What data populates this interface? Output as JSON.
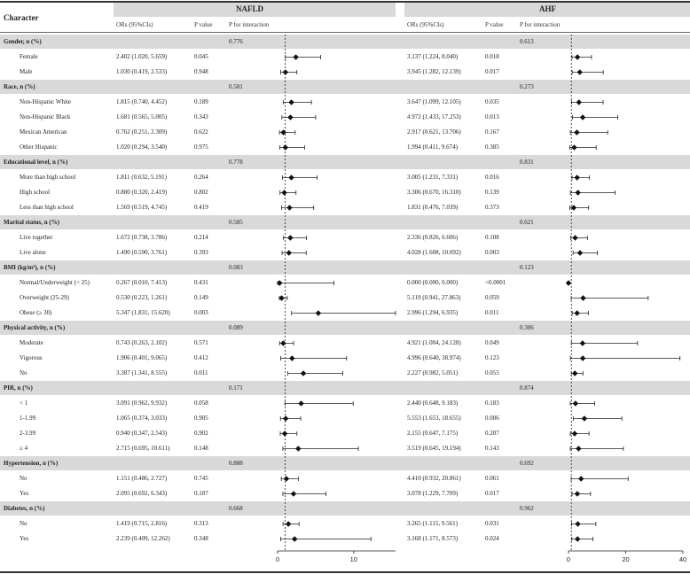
{
  "header": {
    "character": "Character",
    "nafld": "NAFLD",
    "ahf": "AHF",
    "or_label": "ORs (95%CIs)",
    "p_label": "P value",
    "pint_label": "P for interaction"
  },
  "axes": {
    "nafld": {
      "ticks": [
        0,
        10
      ],
      "xmin": 0,
      "xmax": 15.5,
      "ref": 1
    },
    "ahf": {
      "ticks": [
        0,
        20,
        40
      ],
      "xmin": 0,
      "xmax": 40,
      "ref": 1
    }
  },
  "chart_data": {
    "type": "forest",
    "groups": [
      {
        "name": "Gender, n (%)",
        "p_int_nafld": "0.776",
        "p_int_ahf": "0.613",
        "rows": [
          {
            "label": "Female",
            "nafld": {
              "text": "2.402 (1.020, 5.659)",
              "p": "0.045",
              "or": 2.402,
              "lo": 1.02,
              "hi": 5.659
            },
            "ahf": {
              "text": "3.137 (1.224, 8.040)",
              "p": "0.018",
              "or": 3.137,
              "lo": 1.224,
              "hi": 8.04
            }
          },
          {
            "label": "Male",
            "nafld": {
              "text": "1.030 (0.419, 2.533)",
              "p": "0.948",
              "or": 1.03,
              "lo": 0.419,
              "hi": 2.533
            },
            "ahf": {
              "text": "3.945 (1.282, 12.139)",
              "p": "0.017",
              "or": 3.945,
              "lo": 1.282,
              "hi": 12.139
            }
          }
        ]
      },
      {
        "name": "Race, n (%)",
        "p_int_nafld": "0.581",
        "p_int_ahf": "0.273",
        "rows": [
          {
            "label": "Non-Hispanic White",
            "nafld": {
              "text": "1.815 (0.740, 4.452)",
              "p": "0.189",
              "or": 1.815,
              "lo": 0.74,
              "hi": 4.452
            },
            "ahf": {
              "text": "3.647 (1.099, 12.105)",
              "p": "0.035",
              "or": 3.647,
              "lo": 1.099,
              "hi": 12.105
            }
          },
          {
            "label": "Non-Hispanic Black",
            "nafld": {
              "text": "1.681 (0.565, 5.005)",
              "p": "0.343",
              "or": 1.681,
              "lo": 0.565,
              "hi": 5.005
            },
            "ahf": {
              "text": "4.972 (1.433, 17.253)",
              "p": "0.013",
              "or": 4.972,
              "lo": 1.433,
              "hi": 17.253
            }
          },
          {
            "label": "Mexican American",
            "nafld": {
              "text": "0.762 (0.251, 2.309)",
              "p": "0.622",
              "or": 0.762,
              "lo": 0.251,
              "hi": 2.309
            },
            "ahf": {
              "text": "2.917 (0.621, 13.706)",
              "p": "0.167",
              "or": 2.917,
              "lo": 0.621,
              "hi": 13.706
            }
          },
          {
            "label": "Other Hispanic",
            "nafld": {
              "text": "1.020 (0.294, 3.540)",
              "p": "0.975",
              "or": 1.02,
              "lo": 0.294,
              "hi": 3.54
            },
            "ahf": {
              "text": "1.994 (0.411, 9.674)",
              "p": "0.385",
              "or": 1.994,
              "lo": 0.411,
              "hi": 9.674
            }
          }
        ]
      },
      {
        "name": "Educational level, n (%)",
        "p_int_nafld": "0.778",
        "p_int_ahf": "0.831",
        "rows": [
          {
            "label": "More than high school",
            "nafld": {
              "text": "1.811 (0.632, 5.191)",
              "p": "0.264",
              "or": 1.811,
              "lo": 0.632,
              "hi": 5.191
            },
            "ahf": {
              "text": "3.005 (1.231, 7.331)",
              "p": "0.016",
              "or": 3.005,
              "lo": 1.231,
              "hi": 7.331
            }
          },
          {
            "label": "High school",
            "nafld": {
              "text": "0.880 (0.320, 2.419)",
              "p": "0.802",
              "or": 0.88,
              "lo": 0.32,
              "hi": 2.419
            },
            "ahf": {
              "text": "3.306 (0.670, 16.310)",
              "p": "0.139",
              "or": 3.306,
              "lo": 0.67,
              "hi": 16.31
            }
          },
          {
            "label": "Less than high school",
            "nafld": {
              "text": "1.569 (0.519, 4.745)",
              "p": "0.419",
              "or": 1.569,
              "lo": 0.519,
              "hi": 4.745
            },
            "ahf": {
              "text": "1.831 (0.476, 7.039)",
              "p": "0.373",
              "or": 1.831,
              "lo": 0.476,
              "hi": 7.039
            }
          }
        ]
      },
      {
        "name": "Marital status, n (%)",
        "p_int_nafld": "0.585",
        "p_int_ahf": "0.621",
        "rows": [
          {
            "label": "Live together",
            "nafld": {
              "text": "1.672 (0.738, 3.786)",
              "p": "0.214",
              "or": 1.672,
              "lo": 0.738,
              "hi": 3.786
            },
            "ahf": {
              "text": "2.336 (0.826, 6.606)",
              "p": "0.108",
              "or": 2.336,
              "lo": 0.826,
              "hi": 6.606
            }
          },
          {
            "label": "Live alone",
            "nafld": {
              "text": "1.490 (0.590, 3.761)",
              "p": "0.393",
              "or": 1.49,
              "lo": 0.59,
              "hi": 3.761
            },
            "ahf": {
              "text": "4.028 (1.608, 10.092)",
              "p": "0.003",
              "or": 4.028,
              "lo": 1.608,
              "hi": 10.092
            }
          }
        ]
      },
      {
        "name": "BMI (kg/m²), n (%)",
        "p_int_nafld": "0.083",
        "p_int_ahf": "0.123",
        "rows": [
          {
            "label": "Normal/Underweight (< 25)",
            "nafld": {
              "text": "0.267 (0.010, 7.413)",
              "p": "0.431",
              "or": 0.267,
              "lo": 0.01,
              "hi": 7.413
            },
            "ahf": {
              "text": "0.000 (0.000, 0.000)",
              "p": "<0.0001",
              "or": 0.0,
              "lo": 0.0,
              "hi": 0.0
            }
          },
          {
            "label": "Overweight (25-29)",
            "nafld": {
              "text": "0.530 (0.223, 1.261)",
              "p": "0.149",
              "or": 0.53,
              "lo": 0.223,
              "hi": 1.261
            },
            "ahf": {
              "text": "5.119 (0.941, 27.863)",
              "p": "0.059",
              "or": 5.119,
              "lo": 0.941,
              "hi": 27.863
            }
          },
          {
            "label": "Obese (≥ 30)",
            "nafld": {
              "text": "5.347 (1.831, 15.620)",
              "p": "0.003",
              "or": 5.347,
              "lo": 1.831,
              "hi": 15.62
            },
            "ahf": {
              "text": "2.996 (1.294, 6.935)",
              "p": "0.011",
              "or": 2.996,
              "lo": 1.294,
              "hi": 6.935
            }
          }
        ]
      },
      {
        "name": "Physical activity, n (%)",
        "p_int_nafld": "0.089",
        "p_int_ahf": "0.306",
        "rows": [
          {
            "label": "Moderate",
            "nafld": {
              "text": "0.743 (0.263, 2.102)",
              "p": "0.571",
              "or": 0.743,
              "lo": 0.263,
              "hi": 2.102
            },
            "ahf": {
              "text": "4.921 (1.004, 24.128)",
              "p": "0.049",
              "or": 4.921,
              "lo": 1.004,
              "hi": 24.128
            }
          },
          {
            "label": "Vigorous",
            "nafld": {
              "text": "1.906 (0.401, 9.065)",
              "p": "0.412",
              "or": 1.906,
              "lo": 0.401,
              "hi": 9.065
            },
            "ahf": {
              "text": "4.996 (0.640, 38.974)",
              "p": "0.123",
              "or": 4.996,
              "lo": 0.64,
              "hi": 38.974
            }
          },
          {
            "label": "No",
            "nafld": {
              "text": "3.387 (1.341, 8.555)",
              "p": "0.011",
              "or": 3.387,
              "lo": 1.341,
              "hi": 8.555
            },
            "ahf": {
              "text": "2.227 (0.982, 5.051)",
              "p": "0.055",
              "or": 2.227,
              "lo": 0.982,
              "hi": 5.051
            }
          }
        ]
      },
      {
        "name": "PIR, n (%)",
        "p_int_nafld": "0.171",
        "p_int_ahf": "0.874",
        "rows": [
          {
            "label": "< 1",
            "nafld": {
              "text": "3.091 (0.962, 9.932)",
              "p": "0.058",
              "or": 3.091,
              "lo": 0.962,
              "hi": 9.932
            },
            "ahf": {
              "text": "2.440 (0.648, 9.183)",
              "p": "0.183",
              "or": 2.44,
              "lo": 0.648,
              "hi": 9.183
            }
          },
          {
            "label": "1-1.99",
            "nafld": {
              "text": "1.065 (0.374, 3.033)",
              "p": "0.905",
              "or": 1.065,
              "lo": 0.374,
              "hi": 3.033
            },
            "ahf": {
              "text": "5.553 (1.653, 18.655)",
              "p": "0.006",
              "or": 5.553,
              "lo": 1.653,
              "hi": 18.655
            }
          },
          {
            "label": "2-3.99",
            "nafld": {
              "text": "0.940 (0.347, 2.543)",
              "p": "0.902",
              "or": 0.94,
              "lo": 0.347,
              "hi": 2.543
            },
            "ahf": {
              "text": "2.155 (0.647, 7.175)",
              "p": "0.207",
              "or": 2.155,
              "lo": 0.647,
              "hi": 7.175
            }
          },
          {
            "label": "≥ 4",
            "nafld": {
              "text": "2.715 (0.695, 10.611)",
              "p": "0.148",
              "or": 2.715,
              "lo": 0.695,
              "hi": 10.611
            },
            "ahf": {
              "text": "3.519 (0.645, 19.194)",
              "p": "0.143",
              "or": 3.519,
              "lo": 0.645,
              "hi": 19.194
            }
          }
        ]
      },
      {
        "name": "Hypertension, n (%)",
        "p_int_nafld": "0.888",
        "p_int_ahf": "0.692",
        "rows": [
          {
            "label": "No",
            "nafld": {
              "text": "1.151 (0.486, 2.727)",
              "p": "0.745",
              "or": 1.151,
              "lo": 0.486,
              "hi": 2.727
            },
            "ahf": {
              "text": "4.410 (0.932, 20.861)",
              "p": "0.061",
              "or": 4.41,
              "lo": 0.932,
              "hi": 20.861
            }
          },
          {
            "label": "Yes",
            "nafld": {
              "text": "2.095 (0.692, 6.343)",
              "p": "0.187",
              "or": 2.095,
              "lo": 0.692,
              "hi": 6.343
            },
            "ahf": {
              "text": "3.078 (1.229, 7.709)",
              "p": "0.017",
              "or": 3.078,
              "lo": 1.229,
              "hi": 7.709
            }
          }
        ]
      },
      {
        "name": "Diabetes, n (%)",
        "p_int_nafld": "0.668",
        "p_int_ahf": "0.962",
        "rows": [
          {
            "label": "No",
            "nafld": {
              "text": "1.419 (0.715, 2.816)",
              "p": "0.313",
              "or": 1.419,
              "lo": 0.715,
              "hi": 2.816
            },
            "ahf": {
              "text": "3.265 (1.115, 9.561)",
              "p": "0.031",
              "or": 3.265,
              "lo": 1.115,
              "hi": 9.561
            }
          },
          {
            "label": "Yes",
            "nafld": {
              "text": "2.239 (0.409, 12.262)",
              "p": "0.348",
              "or": 2.239,
              "lo": 0.409,
              "hi": 12.262
            },
            "ahf": {
              "text": "3.168 (1.171, 8.573)",
              "p": "0.024",
              "or": 3.168,
              "lo": 1.171,
              "hi": 8.573
            }
          }
        ]
      }
    ]
  }
}
